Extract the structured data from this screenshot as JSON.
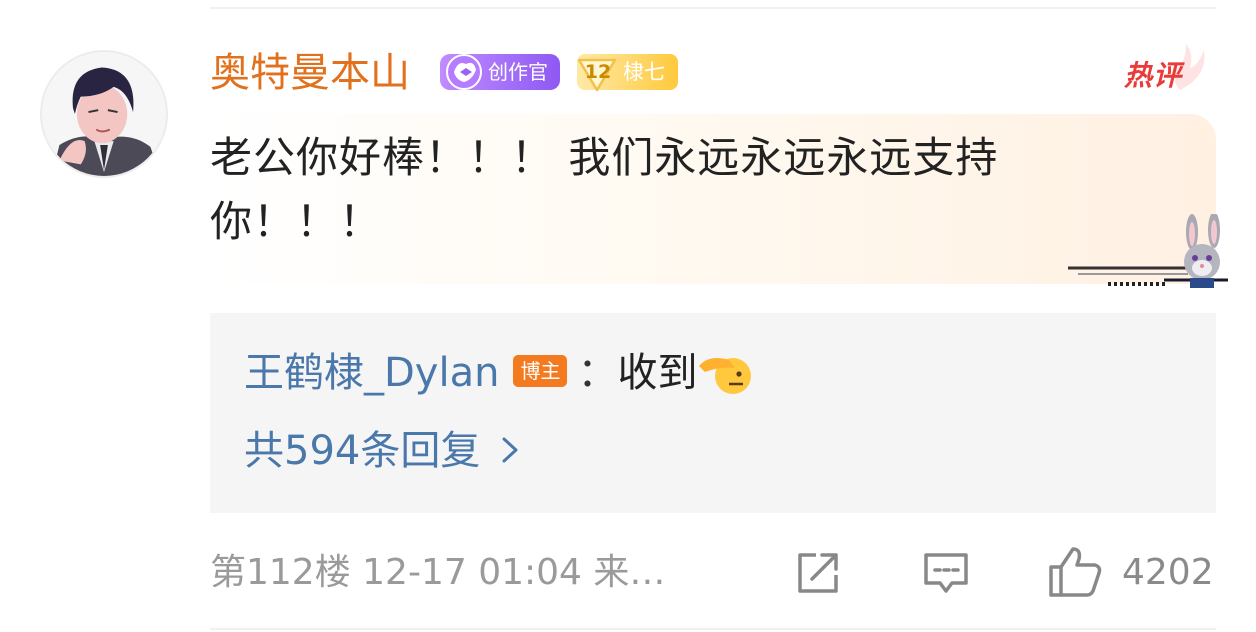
{
  "comment": {
    "username": "奥特曼本山",
    "creator_badge": "创作官",
    "fan_level": "12",
    "fan_badge": "棣七",
    "hot_tag": "热评",
    "text": "老公你好棒！！！ 我们永远永远永远支持你！！！"
  },
  "reply": {
    "user": "王鹤棣_Dylan",
    "badge": "博主",
    "colon": "：",
    "text": "收到",
    "more": "共594条回复"
  },
  "meta": {
    "info": "第112楼 12-17 01:04 来…",
    "like_count": "4202"
  },
  "colors": {
    "username": "#e2711d",
    "link": "#4a78ab",
    "blogger_badge": "#f47a20",
    "hot": "#ea3b3b",
    "creator_badge": "#8e59f3"
  },
  "icons": [
    "avatar-illustration",
    "creator-icon",
    "fan-level-icon",
    "salute-emoji",
    "chevron-right-icon",
    "share-icon",
    "comment-icon",
    "like-icon",
    "rabbit-decoration"
  ]
}
